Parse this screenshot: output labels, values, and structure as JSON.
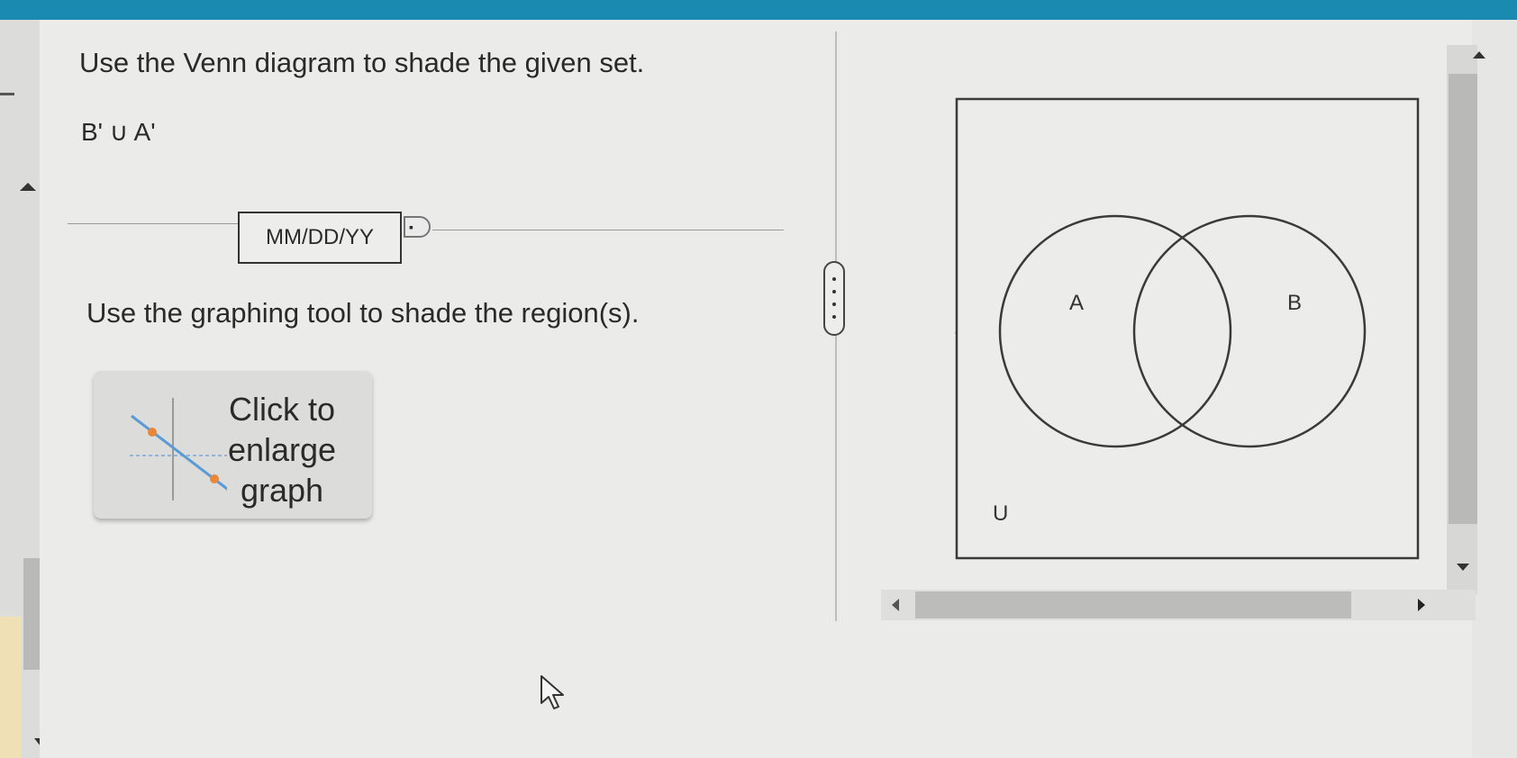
{
  "question": {
    "title": "Use the Venn diagram to shade the given set.",
    "set_expression": "B' ∪ A'",
    "date_placeholder": "MM/DD/YY",
    "instruction": "Use the graphing tool to shade the region(s).",
    "enlarge_button_label": "Click to enlarge graph"
  },
  "venn": {
    "set_a_label": "A",
    "set_b_label": "B",
    "universe_label": "U"
  },
  "colors": {
    "top_bar": "#1b8ab0",
    "outline": "#3a3a3a",
    "graph_icon_line": "#5b9bd5",
    "graph_icon_point": "#e8873a"
  }
}
